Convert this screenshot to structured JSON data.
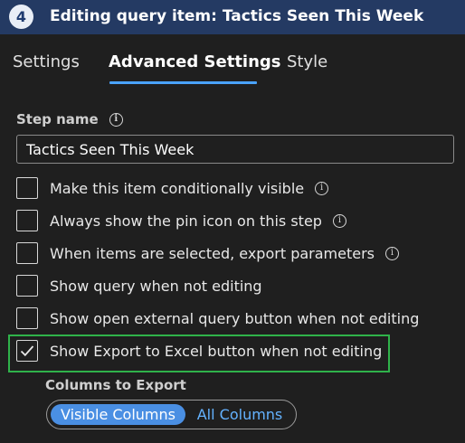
{
  "header": {
    "step_number": "4",
    "title": "Editing query item: Tactics Seen This Week"
  },
  "tabs": [
    {
      "label": "Settings",
      "active": false
    },
    {
      "label": "Advanced Settings",
      "active": true
    },
    {
      "label": "Style",
      "active": false
    }
  ],
  "step_name": {
    "label": "Step name",
    "value": "Tactics Seen This Week"
  },
  "options": [
    {
      "label": "Make this item conditionally visible",
      "checked": false,
      "info": true
    },
    {
      "label": "Always show the pin icon on this step",
      "checked": false,
      "info": true
    },
    {
      "label": "When items are selected, export parameters",
      "checked": false,
      "info": true
    },
    {
      "label": "Show query when not editing",
      "checked": false,
      "info": false
    },
    {
      "label": "Show open external query button when not editing",
      "checked": false,
      "info": false
    },
    {
      "label": "Show Export to Excel button when not editing",
      "checked": true,
      "info": false
    }
  ],
  "columns_to_export": {
    "label": "Columns to Export",
    "choices": [
      "Visible Columns",
      "All Columns"
    ],
    "selected": "Visible Columns"
  },
  "colors": {
    "title_bar": "#243a63",
    "accent": "#4aa3ff",
    "highlight": "#2fb24a",
    "toggle_selected": "#4a8fe3"
  }
}
